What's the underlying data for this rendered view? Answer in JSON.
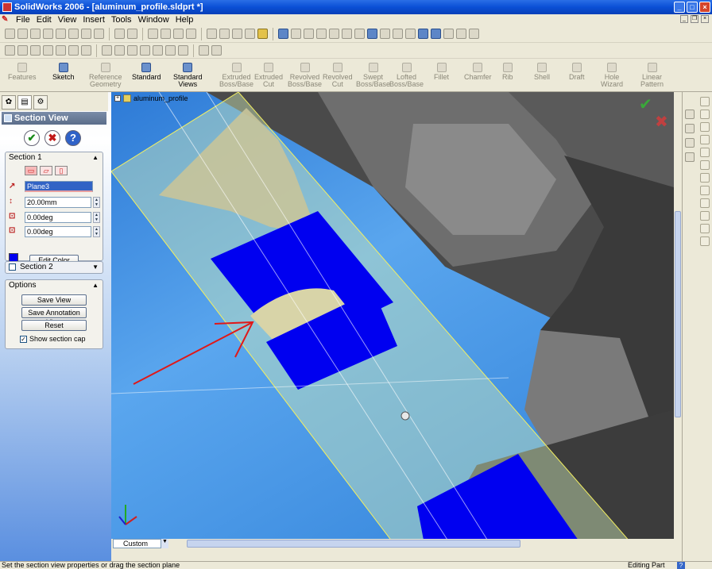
{
  "window": {
    "title": "SolidWorks 2006 - [aluminum_profile.sldprt *]"
  },
  "menu": {
    "items": [
      "File",
      "Edit",
      "View",
      "Insert",
      "Tools",
      "Window",
      "Help"
    ]
  },
  "command_manager": {
    "items": [
      {
        "label": "Features",
        "enabled": false
      },
      {
        "label": "Sketch",
        "enabled": true
      },
      {
        "label": "Reference\nGeometry",
        "enabled": false
      },
      {
        "label": "Standard",
        "enabled": true
      },
      {
        "label": "Standard\nViews",
        "enabled": true
      },
      {
        "label": "Extruded\nBoss/Base",
        "enabled": false
      },
      {
        "label": "Extruded\nCut",
        "enabled": false
      },
      {
        "label": "Revolved\nBoss/Base",
        "enabled": false
      },
      {
        "label": "Revolved\nCut",
        "enabled": false
      },
      {
        "label": "Swept\nBoss/Base",
        "enabled": false
      },
      {
        "label": "Lofted\nBoss/Base",
        "enabled": false
      },
      {
        "label": "Fillet",
        "enabled": false
      },
      {
        "label": "Chamfer",
        "enabled": false
      },
      {
        "label": "Rib",
        "enabled": false
      },
      {
        "label": "Shell",
        "enabled": false
      },
      {
        "label": "Draft",
        "enabled": false
      },
      {
        "label": "Hole\nWizard",
        "enabled": false
      },
      {
        "label": "Linear\nPattern",
        "enabled": false
      }
    ]
  },
  "property_manager": {
    "title": "Section View",
    "section1": {
      "label": "Section 1",
      "plane": "Plane3",
      "offset": "20.00mm",
      "rotate_x": "0.00deg",
      "rotate_y": "0.00deg",
      "edit_color_label": "Edit Color",
      "cap_color": "#0000f0"
    },
    "section2": {
      "label": "Section 2"
    },
    "options": {
      "label": "Options",
      "save_view": "Save View",
      "save_annotation_view": "Save Annotation View",
      "reset": "Reset",
      "show_section_cap": "Show section cap",
      "show_section_cap_checked": true
    }
  },
  "viewport": {
    "tree_root": "aluminum_profile",
    "view_orientation": "Custom",
    "colors": {
      "section_cap": "#0000f0",
      "background": "#3e8ee6",
      "section_plane": "#cfe8b8"
    }
  },
  "statusbar": {
    "message": "Set the section view properties or drag the section plane",
    "mode": "Editing Part",
    "help": "?"
  }
}
